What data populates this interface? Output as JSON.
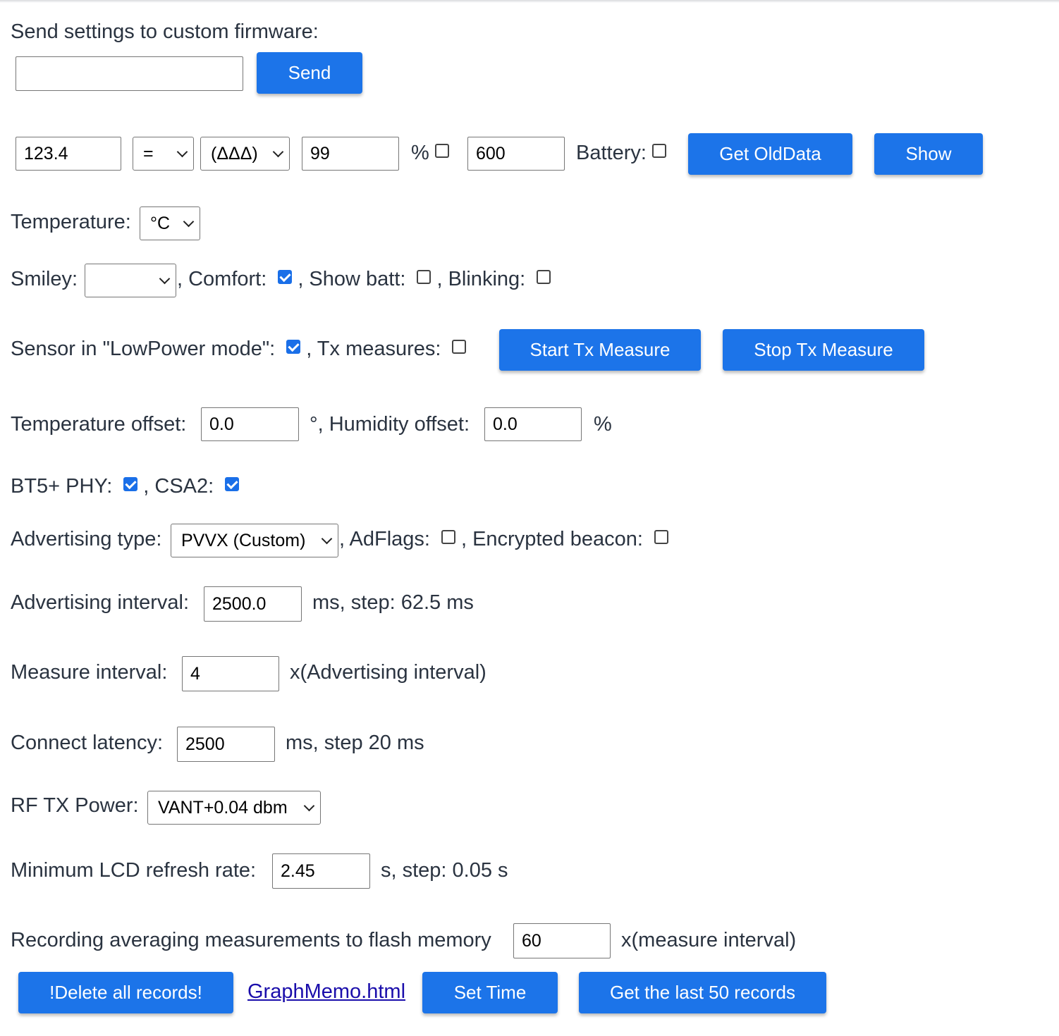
{
  "send_row": {
    "label": "Send settings to custom firmware:",
    "input_value": "",
    "send_button": "Send"
  },
  "old_data_row": {
    "value_input": "123.4",
    "operator_select": "=",
    "symbol_select": "(ΔΔΔ)",
    "percent_input": "99",
    "percent_label": "%",
    "percent_checked": false,
    "count_input": "600",
    "battery_label": "Battery:",
    "battery_checked": false,
    "get_old_data_button": "Get OldData",
    "show_button": "Show"
  },
  "temperature": {
    "label": "Temperature:",
    "unit_select": "°C"
  },
  "smiley_row": {
    "smiley_label": "Smiley:",
    "smiley_select": "",
    "comfort_label": ", Comfort:",
    "comfort_checked": true,
    "show_batt_label": ", Show batt:",
    "show_batt_checked": false,
    "blinking_label": ", Blinking:",
    "blinking_checked": false
  },
  "lowpower_row": {
    "lowpower_label": "Sensor in \"LowPower mode\":",
    "lowpower_checked": true,
    "tx_measures_label": ", Tx measures:",
    "tx_measures_checked": false,
    "start_button": "Start Tx Measure",
    "stop_button": "Stop Tx Measure"
  },
  "offset_row": {
    "temp_offset_label": "Temperature offset:",
    "temp_offset_value": "0.0",
    "hum_offset_label": "°, Humidity offset:",
    "hum_offset_value": "0.0",
    "percent_unit": "%"
  },
  "phy_row": {
    "bt5_label": "BT5+ PHY:",
    "bt5_checked": true,
    "csa2_label": ", CSA2:",
    "csa2_checked": true
  },
  "adv_type_row": {
    "label": "Advertising type:",
    "select_value": "PVVX (Custom)",
    "adflags_label": ", AdFlags:",
    "adflags_checked": false,
    "encrypted_label": ", Encrypted beacon:",
    "encrypted_checked": false
  },
  "adv_interval_row": {
    "label": "Advertising interval:",
    "value": "2500.0",
    "unit": "ms, step: 62.5 ms"
  },
  "measure_interval_row": {
    "label": "Measure interval:",
    "value": "4",
    "unit": "x(Advertising interval)"
  },
  "connect_latency_row": {
    "label": "Connect latency:",
    "value": "2500",
    "unit": "ms, step 20 ms"
  },
  "rf_power_row": {
    "label": "RF TX Power:",
    "select_value": "VANT+0.04 dbm"
  },
  "lcd_row": {
    "label": "Minimum LCD refresh rate:",
    "value": "2.45",
    "unit": "s, step: 0.05 s"
  },
  "recording_row": {
    "label": "Recording averaging measurements to flash memory",
    "value": "60",
    "unit": "x(measure interval)"
  },
  "bottom_row": {
    "delete_button": "!Delete all records!",
    "graph_link": "GraphMemo.html",
    "set_time_button": "Set Time",
    "last_records_button": "Get the last 50 records"
  }
}
